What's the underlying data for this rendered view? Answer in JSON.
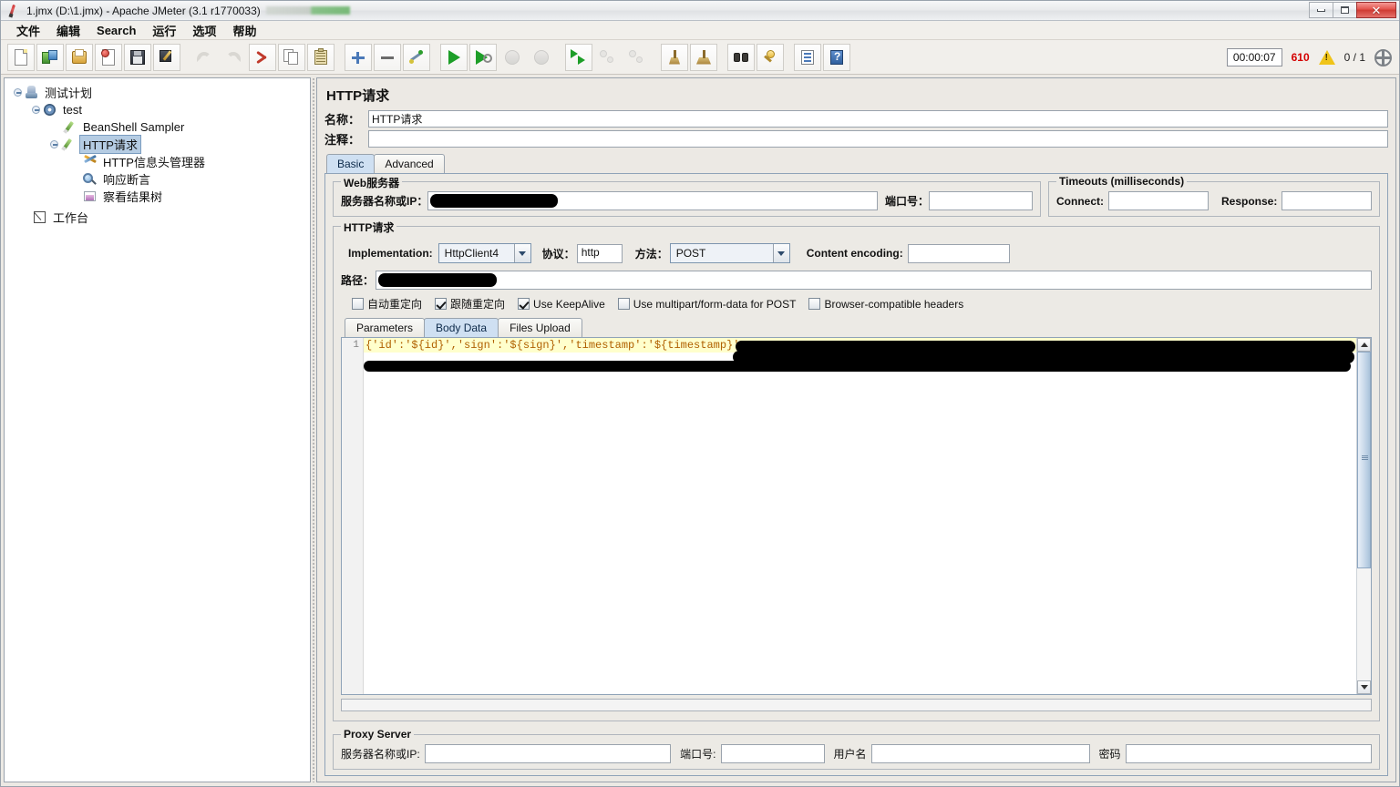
{
  "window": {
    "title": "1.jmx (D:\\1.jmx) - Apache JMeter (3.1 r1770033)",
    "app_icon": "jmeter-feather-icon",
    "minimize": "minimize-icon",
    "maximize": "restore-icon",
    "close": "close-icon"
  },
  "menubar": {
    "items": [
      {
        "label": "文件",
        "name": "menu-file"
      },
      {
        "label": "编辑",
        "name": "menu-edit"
      },
      {
        "label": "Search",
        "name": "menu-search"
      },
      {
        "label": "运行",
        "name": "menu-run"
      },
      {
        "label": "选项",
        "name": "menu-options"
      },
      {
        "label": "帮助",
        "name": "menu-help"
      }
    ]
  },
  "toolbar": {
    "buttons": [
      {
        "icon": "new-file-icon",
        "title": "新建"
      },
      {
        "icon": "templates-icon",
        "title": "模板"
      },
      {
        "icon": "open-folder-icon",
        "title": "打开"
      },
      {
        "icon": "close-document-icon",
        "title": "关闭"
      },
      {
        "icon": "save-icon",
        "title": "保存"
      },
      {
        "icon": "save-as-icon",
        "title": "另存为"
      },
      {
        "icon": "undo-icon",
        "title": "撤销",
        "disabled": true
      },
      {
        "icon": "redo-icon",
        "title": "重做",
        "disabled": true
      },
      {
        "icon": "cut-icon",
        "title": "剪切"
      },
      {
        "icon": "copy-icon",
        "title": "复制"
      },
      {
        "icon": "paste-icon",
        "title": "粘贴"
      },
      {
        "icon": "expand-all-icon",
        "title": "展开全部"
      },
      {
        "icon": "collapse-all-icon",
        "title": "收起全部"
      },
      {
        "icon": "toggle-icon",
        "title": "启用/禁用"
      },
      {
        "icon": "start-icon",
        "title": "启动"
      },
      {
        "icon": "start-no-pauses-icon",
        "title": "无间隔启动"
      },
      {
        "icon": "stop-icon",
        "title": "停止",
        "disabled": true
      },
      {
        "icon": "shutdown-icon",
        "title": "关闭",
        "disabled": true
      },
      {
        "icon": "remote-start-all-icon",
        "title": "远程全部启动"
      },
      {
        "icon": "remote-stop-all-icon",
        "title": "远程全部停止",
        "disabled": true
      },
      {
        "icon": "remote-shutdown-all-icon",
        "title": "远程全部关闭",
        "disabled": true
      },
      {
        "icon": "clear-icon",
        "title": "清除"
      },
      {
        "icon": "clear-all-icon",
        "title": "清除全部"
      },
      {
        "icon": "search-icon",
        "title": "查找"
      },
      {
        "icon": "search-reset-icon",
        "title": "重置查找"
      },
      {
        "icon": "function-helper-icon",
        "title": "函数助手"
      },
      {
        "icon": "help-icon",
        "title": "帮助"
      }
    ],
    "status": {
      "elapsed_time": "00:00:07",
      "error_count": "610",
      "warning_icon": "warning-triangle-icon",
      "threads": "0 / 1",
      "remote_icon": "connection-status-icon",
      "error_color": "#d40000",
      "warning_color": "#f0c419"
    }
  },
  "tree": {
    "nodes": [
      {
        "label": "测试计划",
        "icon": "test-plan-icon",
        "depth": 0,
        "selected": false,
        "expandable": true
      },
      {
        "label": "test",
        "icon": "thread-group-icon",
        "depth": 1,
        "selected": false,
        "expandable": true
      },
      {
        "label": "BeanShell Sampler",
        "icon": "sampler-icon",
        "depth": 2,
        "selected": false,
        "expandable": false
      },
      {
        "label": "HTTP请求",
        "icon": "sampler-icon",
        "depth": 2,
        "selected": true,
        "expandable": true
      },
      {
        "label": "HTTP信息头管理器",
        "icon": "header-manager-icon",
        "depth": 3,
        "selected": false,
        "expandable": false
      },
      {
        "label": "响应断言",
        "icon": "assertion-icon",
        "depth": 3,
        "selected": false,
        "expandable": false
      },
      {
        "label": "察看结果树",
        "icon": "view-results-tree-icon",
        "depth": 3,
        "selected": false,
        "expandable": false
      },
      {
        "label": "工作台",
        "icon": "workbench-icon",
        "depth": 0,
        "selected": false,
        "expandable": false
      }
    ],
    "selection_color": "#b5cce3"
  },
  "main": {
    "panel_title": "HTTP请求",
    "name_label": "名称：",
    "name_value": "HTTP请求",
    "comment_label": "注释：",
    "comment_value": "",
    "tabs": [
      {
        "label": "Basic",
        "active": true
      },
      {
        "label": "Advanced",
        "active": false
      }
    ],
    "web_server": {
      "group_title": "Web服务器",
      "host_label": "服务器名称或IP：",
      "host_value": "",
      "host_redacted": true,
      "port_label": "端口号：",
      "port_value": ""
    },
    "timeouts": {
      "group_title": "Timeouts (milliseconds)",
      "connect_label": "Connect:",
      "connect_value": "",
      "response_label": "Response:",
      "response_value": ""
    },
    "http_request": {
      "group_title": "HTTP请求",
      "implementation_label": "Implementation:",
      "implementation_value": "HttpClient4",
      "protocol_label": "协议：",
      "protocol_value": "http",
      "method_label": "方法：",
      "method_value": "POST",
      "content_encoding_label": "Content encoding:",
      "content_encoding_value": "",
      "path_label": "路径：",
      "path_value": "",
      "path_redacted": true,
      "checkboxes": [
        {
          "label": "自动重定向",
          "checked": false
        },
        {
          "label": "跟随重定向",
          "checked": true
        },
        {
          "label": "Use KeepAlive",
          "checked": true
        },
        {
          "label": "Use multipart/form-data for POST",
          "checked": false
        },
        {
          "label": "Browser-compatible headers",
          "checked": false
        }
      ],
      "data_tabs": [
        {
          "label": "Parameters",
          "active": false
        },
        {
          "label": "Body Data",
          "active": true
        },
        {
          "label": "Files Upload",
          "active": false
        }
      ],
      "body_editor": {
        "line_number": "1",
        "line_text": "{'id':'${id}','sign':'${sign}','timestamp':'${timestamp}'",
        "line_highlight_color": "#ffffcc",
        "text_color": "#b06000",
        "redacted_tail": true,
        "scroll_up_icon": "scroll-up-arrow-icon",
        "scroll_down_icon": "scroll-down-arrow-icon"
      }
    },
    "proxy_server": {
      "group_title": "Proxy Server",
      "host_label": "服务器名称或IP:",
      "host_value": "",
      "port_label": "端口号:",
      "port_value": "",
      "username_label": "用户名",
      "username_value": "",
      "password_label": "密码",
      "password_value": ""
    }
  }
}
